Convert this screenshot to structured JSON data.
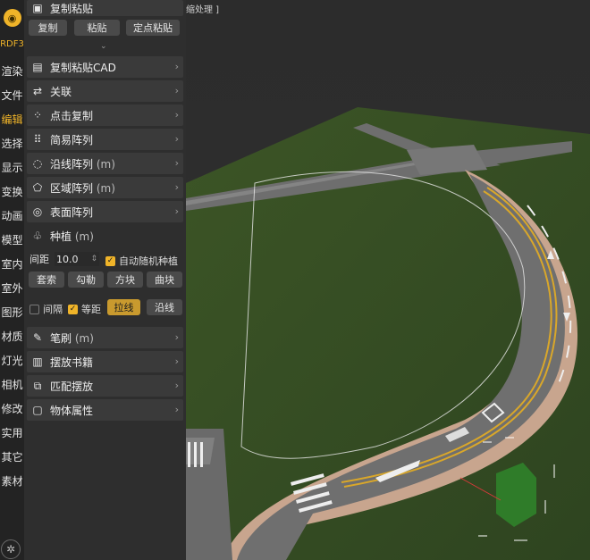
{
  "viewport": {
    "caption": "缩处理 ]"
  },
  "rail": {
    "brand": "RDF3",
    "items": [
      {
        "label": "渲染",
        "active": false
      },
      {
        "label": "文件",
        "active": false
      },
      {
        "label": "编辑",
        "active": true
      },
      {
        "label": "选择",
        "active": false
      },
      {
        "label": "显示",
        "active": false
      },
      {
        "label": "变换",
        "active": false
      },
      {
        "label": "动画",
        "active": false
      },
      {
        "label": "模型",
        "active": false
      },
      {
        "label": "室内",
        "active": false
      },
      {
        "label": "室外",
        "active": false
      },
      {
        "label": "图形",
        "active": false
      },
      {
        "label": "材质",
        "active": false
      },
      {
        "label": "灯光",
        "active": false
      },
      {
        "label": "相机",
        "active": false
      },
      {
        "label": "修改",
        "active": false
      },
      {
        "label": "实用",
        "active": false
      },
      {
        "label": "其它",
        "active": false
      },
      {
        "label": "素材",
        "active": false
      }
    ]
  },
  "panel": {
    "copy_paste": {
      "title": "复制粘贴",
      "copy": "复制",
      "paste": "粘贴",
      "point_paste": "定点粘贴"
    },
    "copy_paste_cad": "复制粘贴CAD",
    "link": "关联",
    "click_copy": "点击复制",
    "simple_array": "简易阵列",
    "path_array": "沿线阵列",
    "path_array_unit": "(m)",
    "area_array": "区域阵列",
    "area_array_unit": "(m)",
    "surface_array": "表面阵列",
    "planting": {
      "title": "种植",
      "unit": "(m)",
      "spacing_label": "间距",
      "spacing_value": "10.0",
      "auto_random": "自动随机种植",
      "btn_lasso": "套索",
      "btn_outline": "勾勒",
      "btn_block": "方块",
      "btn_curve": "曲块",
      "opt_interval": "间隔",
      "opt_equal": "等距",
      "btn_line": "拉线",
      "btn_along": "沿线"
    },
    "brush": "笔刷",
    "brush_unit": "(m)",
    "place_books": "摆放书籍",
    "match_place": "匹配摆放",
    "object_props": "物体属性"
  }
}
